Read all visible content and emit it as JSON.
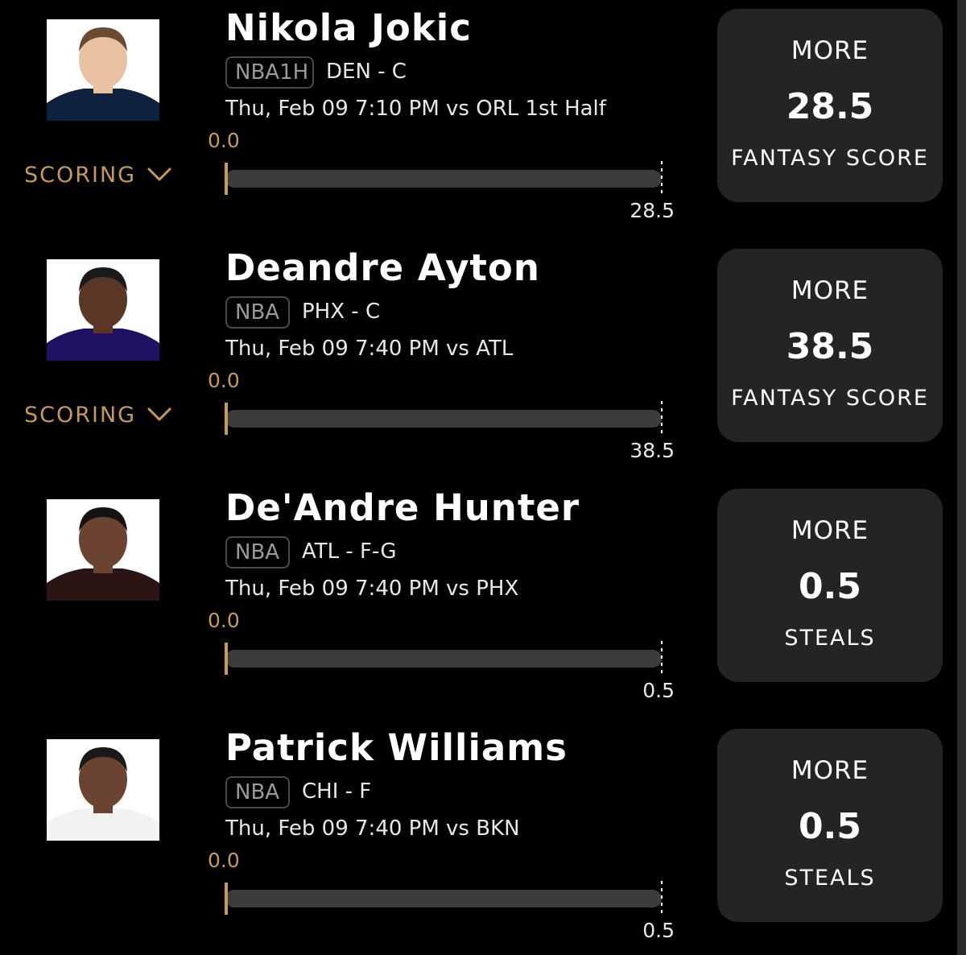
{
  "colors": {
    "accent": "#c89a58",
    "card": "#242424",
    "bar": "#3c3c3c"
  },
  "projections": [
    {
      "player": "Nikola Jokic",
      "league": "NBA1H",
      "team": "DEN - C",
      "game": "Thu, Feb 09 7:10 PM  vs ORL 1st Half",
      "progress_start": "0.0",
      "line": "28.5",
      "current_fraction": 0,
      "direction": "MORE",
      "stat": "FANTASY SCORE",
      "scoring_label": "SCORING",
      "has_scoring": true,
      "jersey_color": "#0e2240",
      "skin": "#e8c1a0",
      "hair": "#6b4a33"
    },
    {
      "player": "Deandre Ayton",
      "league": "NBA",
      "team": "PHX - C",
      "game": "Thu, Feb 09 7:40 PM  vs ATL",
      "progress_start": "0.0",
      "line": "38.5",
      "current_fraction": 0,
      "direction": "MORE",
      "stat": "FANTASY SCORE",
      "scoring_label": "SCORING",
      "has_scoring": true,
      "jersey_color": "#1d1160",
      "skin": "#5a3724",
      "hair": "#1a1a1a"
    },
    {
      "player": "De'Andre Hunter",
      "league": "NBA",
      "team": "ATL - F-G",
      "game": "Thu, Feb 09 7:40 PM  vs PHX",
      "progress_start": "0.0",
      "line": "0.5",
      "current_fraction": 0,
      "direction": "MORE",
      "stat": "STEALS",
      "scoring_label": "",
      "has_scoring": false,
      "jersey_color": "#2a1414",
      "skin": "#6b4330",
      "hair": "#141414"
    },
    {
      "player": "Patrick Williams",
      "league": "NBA",
      "team": "CHI - F",
      "game": "Thu, Feb 09 7:40 PM  vs BKN",
      "progress_start": "0.0",
      "line": "0.5",
      "current_fraction": 0,
      "direction": "MORE",
      "stat": "STEALS",
      "scoring_label": "",
      "has_scoring": false,
      "jersey_color": "#f2f2f2",
      "skin": "#6a4431",
      "hair": "#1a1a1a"
    }
  ]
}
